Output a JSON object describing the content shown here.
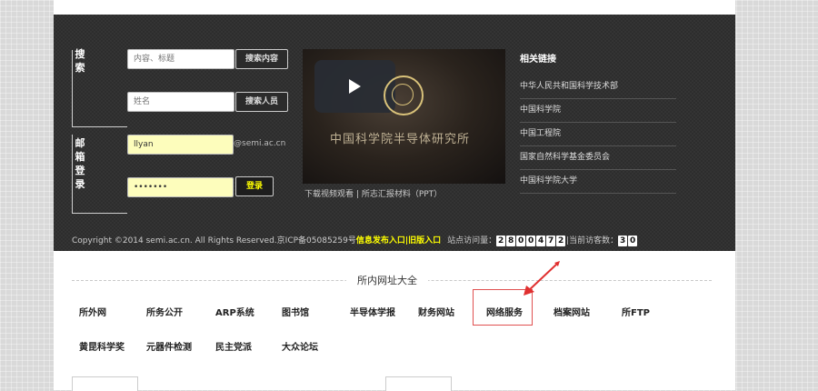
{
  "search": {
    "label": "搜索",
    "content_placeholder": "内容、标题",
    "content_button": "搜索内容",
    "person_placeholder": "姓名",
    "person_button": "搜索人员"
  },
  "mail": {
    "label": "邮箱登录",
    "username": "llyan",
    "domain_suffix": "@semi.ac.cn",
    "password": "•••••••",
    "login_button": "登录"
  },
  "video": {
    "caption": "中国科学院半导体研究所",
    "links": [
      "下载视频观看",
      "|",
      "所志汇报材料（PPT）"
    ]
  },
  "related": {
    "title": "相关链接",
    "items": [
      "中华人民共和国科学技术部",
      "中国科学院",
      "中国工程院",
      "国家自然科学基金委员会",
      "中国科学院大学"
    ]
  },
  "footer": {
    "copyright": "Copyright ©2014 semi.ac.cn. All Rights Reserved.京ICP备05085259号",
    "link1": "信息发布入口",
    "sep": "|",
    "link2": "旧版入口",
    "visits_label": "站点访问量：",
    "visits_digits": [
      "2",
      "8",
      "0",
      "0",
      "4",
      "7",
      "2"
    ],
    "online_label": "|当前访客数：",
    "online_digits": [
      "3",
      "0"
    ]
  },
  "section": {
    "title": "所内网址大全",
    "row1": [
      "所外网",
      "所务公开",
      "ARP系统",
      "图书馆",
      "半导体学报",
      "财务网站",
      "网络服务",
      "档案网站",
      "所FTP"
    ],
    "row2": [
      "黄昆科学奖",
      "元器件检测",
      "民主党派",
      "大众论坛"
    ]
  },
  "colors": {
    "dark_bg": "#2d2d2d",
    "input_yellow": "#fdfdbc",
    "highlight_yellow": "#ffff00",
    "annotation_red": "#e03030"
  },
  "icons": {
    "play": "play-icon",
    "seal": "seal-logo-icon",
    "arrow": "red-arrow-annotation"
  }
}
